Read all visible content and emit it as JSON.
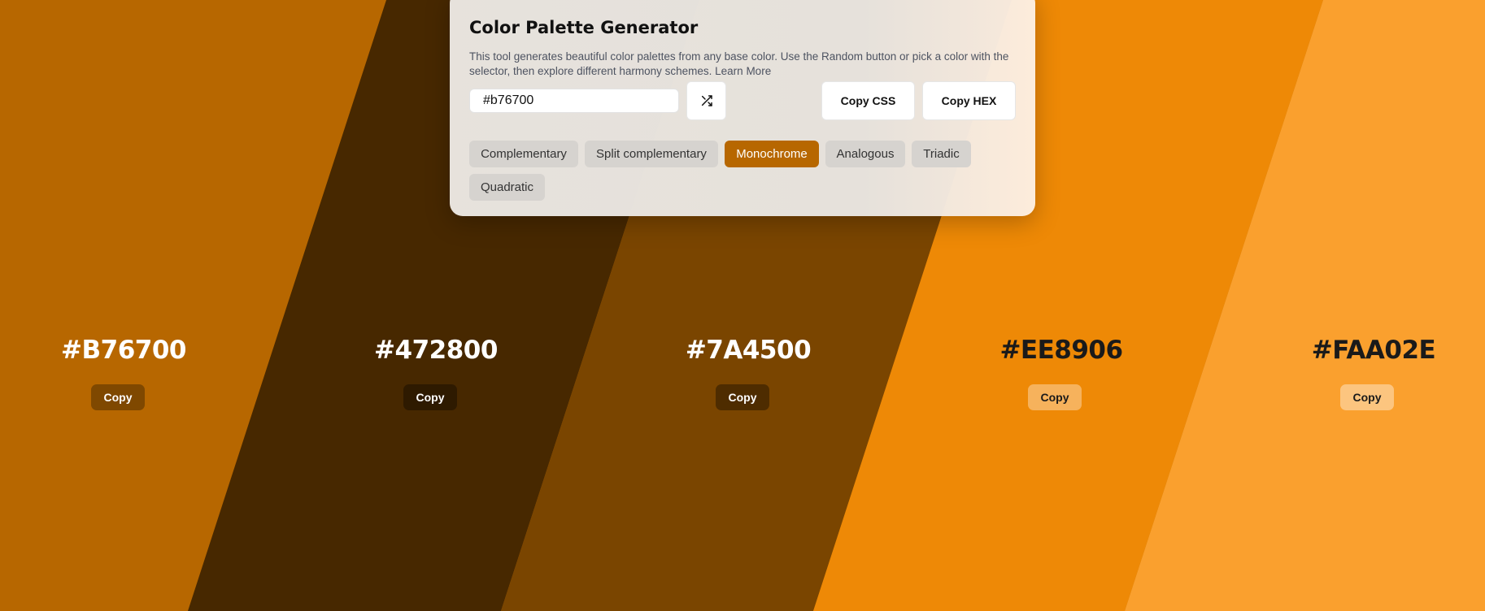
{
  "colors": {
    "base": "#b76700",
    "active_mode": "#b76700"
  },
  "swatches": [
    {
      "hex": "#B76700",
      "copy_label": "Copy",
      "bg": "#b76700",
      "text_color": "#ffffff",
      "btn_bg": "#7f4800",
      "btn_text": "#ffffff"
    },
    {
      "hex": "#472800",
      "copy_label": "Copy",
      "bg": "#472800",
      "text_color": "#ffffff",
      "btn_bg": "#2e1a00",
      "btn_text": "#ffffff"
    },
    {
      "hex": "#7A4500",
      "copy_label": "Copy",
      "bg": "#7a4500",
      "text_color": "#ffffff",
      "btn_bg": "#4e2c00",
      "btn_text": "#ffffff"
    },
    {
      "hex": "#EE8906",
      "copy_label": "Copy",
      "bg": "#ee8906",
      "text_color": "#1a1a1a",
      "btn_bg": "#f6b25c",
      "btn_text": "#1a1a1a"
    },
    {
      "hex": "#FAA02E",
      "copy_label": "Copy",
      "bg": "#faa02e",
      "text_color": "#1a1a1a",
      "btn_bg": "#fcc57f",
      "btn_text": "#1a1a1a"
    }
  ],
  "panel": {
    "title": "Color Palette Generator",
    "description": "This tool generates beautiful color palettes from any base color. Use the Random button or pick a color with the selector, then explore different harmony schemes. Learn More",
    "input_value": "#b76700",
    "random_icon": "shuffle-icon",
    "copy_css_label": "Copy CSS",
    "copy_hex_label": "Copy HEX",
    "modes": [
      {
        "label": "Complementary",
        "active": false
      },
      {
        "label": "Split complementary",
        "active": false
      },
      {
        "label": "Monochrome",
        "active": true
      },
      {
        "label": "Analogous",
        "active": false
      },
      {
        "label": "Triadic",
        "active": false
      },
      {
        "label": "Quadratic",
        "active": false
      }
    ]
  }
}
